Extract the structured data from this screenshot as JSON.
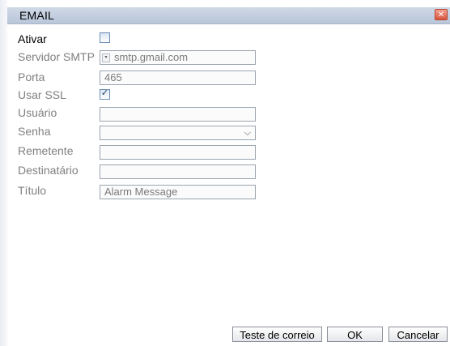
{
  "window": {
    "title": "EMAIL",
    "close_symbol": "✕"
  },
  "form": {
    "ativar": {
      "label": "Ativar",
      "checked": false
    },
    "servidor_smtp": {
      "label": "Servidor SMTP",
      "value": "smtp.gmail.com",
      "dropdown_symbol": "▾"
    },
    "porta": {
      "label": "Porta",
      "value": "465"
    },
    "usar_ssl": {
      "label": "Usar SSL",
      "checked": true,
      "tick": "✓"
    },
    "usuario": {
      "label": "Usuário",
      "value": ""
    },
    "senha": {
      "label": "Senha",
      "value": "",
      "chevron": "⌵"
    },
    "remetente": {
      "label": "Remetente",
      "value": ""
    },
    "destinatario": {
      "label": "Destinatário",
      "value": ""
    },
    "titulo": {
      "label": "Título",
      "value": "Alarm Message"
    }
  },
  "buttons": {
    "test_mail": "Teste de correio",
    "ok": "OK",
    "cancel": "Cancelar"
  },
  "colors": {
    "titlebar": "#c3cfe0",
    "close": "#d9543c",
    "label_disabled": "#808080",
    "label_enabled": "#000000"
  }
}
